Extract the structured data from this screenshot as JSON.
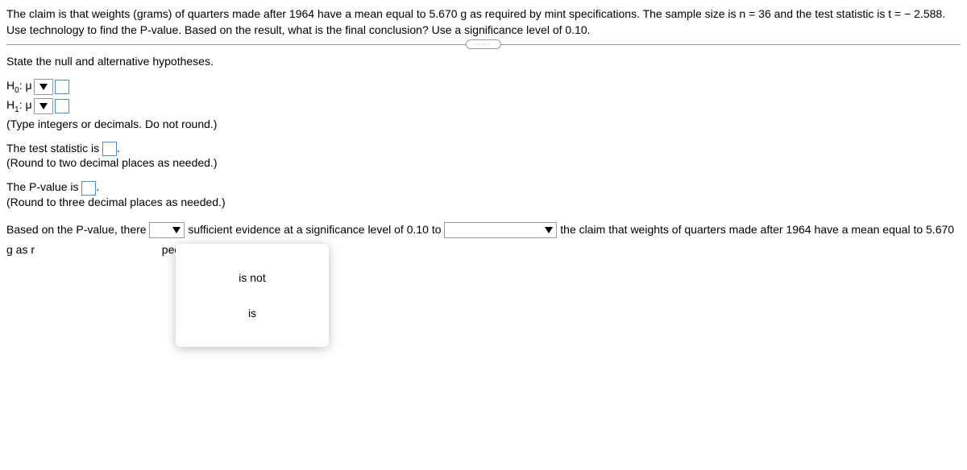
{
  "problem": {
    "line1": "The claim is that weights (grams) of quarters made after 1964 have a mean equal to 5.670 g as required by mint specifications. The sample size is n = 36 and the test statistic is t = − 2.588. Use technology to find the P-value. Based on the result, what is the final conclusion? Use a significance level of 0.10."
  },
  "prompts": {
    "state_hypotheses": "State the null and alternative hypotheses.",
    "h0_label": "H",
    "h0_sub": "0",
    "h0_colon": ": μ",
    "h1_label": "H",
    "h1_sub": "1",
    "h1_colon": ": μ",
    "hypotheses_hint": "(Type integers or decimals. Do not round.)",
    "test_stat_prefix": "The test statistic is ",
    "test_stat_suffix": ".",
    "test_stat_hint": "(Round to two decimal places as needed.)",
    "pvalue_prefix": "The P-value is ",
    "pvalue_suffix": ".",
    "pvalue_hint": "(Round to three decimal places as needed.)",
    "conclusion_part1": "Based on the P-value, there ",
    "conclusion_part2": " sufficient evidence at a significance level of 0.10 to ",
    "conclusion_part3": " the claim that weights of quarters made after 1964 have a mean equal to 5.670 g as r",
    "conclusion_part4": "pecifications."
  },
  "dropdown_options": {
    "option1": "is not",
    "option2": "is"
  },
  "divider_dots": "....."
}
